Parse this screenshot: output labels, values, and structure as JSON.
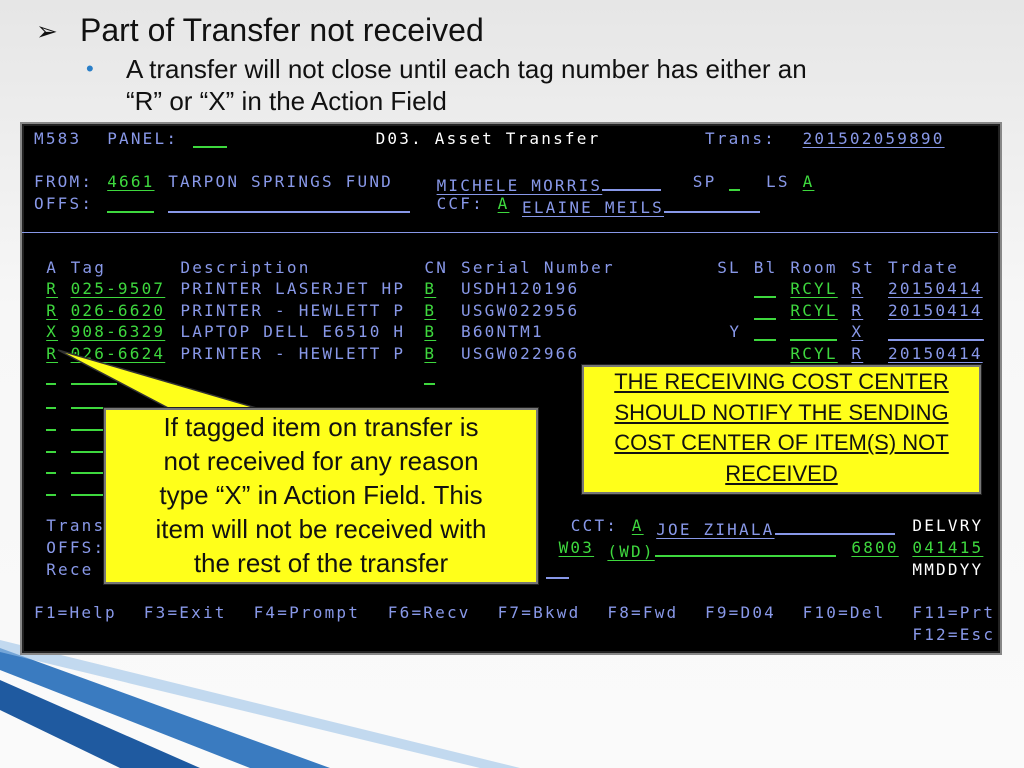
{
  "slide": {
    "title": "Part of Transfer not received",
    "bullet": "A transfer will not close until each tag number has either an",
    "bullet_line2": "“R” or “X” in the Action Field"
  },
  "terminal": {
    "program": "M583",
    "panel_label": "PANEL:",
    "screen_title": "D03. Asset Transfer",
    "trans_label": "Trans:",
    "trans_number": "201502059890",
    "from_label": "FROM:",
    "from_code": "4661",
    "from_name": "TARPON SPRINGS FUND",
    "from_contact": "MICHELE MORRIS",
    "sp_label": "SP",
    "ls_label": "LS",
    "ls_value": "A",
    "offs_label": "OFFS:",
    "ccf_label": "CCF:",
    "ccf_value": "A",
    "ccf_contact": "ELAINE MEILS",
    "columns": [
      "A",
      "Tag",
      "Description",
      "CN",
      "Serial Number",
      "SL",
      "Bl",
      "Room",
      "St",
      "Trdate"
    ],
    "rows": [
      {
        "action": "R",
        "tag": "025-9507",
        "description": "PRINTER LASERJET HP",
        "cn": "B",
        "serial": "USDH120196",
        "sl": "",
        "room": "RCYL",
        "st": "R",
        "trdate": "20150414"
      },
      {
        "action": "R",
        "tag": "026-6620",
        "description": "PRINTER - HEWLETT P",
        "cn": "B",
        "serial": "USGW022956",
        "sl": "",
        "room": "RCYL",
        "st": "R",
        "trdate": "20150414"
      },
      {
        "action": "X",
        "tag": "908-6329",
        "description": "LAPTOP DELL E6510 H",
        "cn": "B",
        "serial": "B60NTM1",
        "sl": "Y",
        "room": "",
        "st": "X",
        "trdate": ""
      },
      {
        "action": "R",
        "tag": "026-6624",
        "description": "PRINTER - HEWLETT P",
        "cn": "B",
        "serial": "USGW022966",
        "sl": "",
        "room": "RCYL",
        "st": "R",
        "trdate": "20150414"
      }
    ],
    "trans_label_bottom": "Trans",
    "offs_label_bottom": "OFFS:",
    "rece_label": "Rece",
    "cct_label": "CCT:",
    "cct_value": "A",
    "cct_contact": "JOE ZIHALA",
    "delvry_label": "DELVRY",
    "offs_code": "W03",
    "offs_name": "(WD)",
    "offs_number": "6800",
    "delivery_date": "041415",
    "date_format": "MMDDYY",
    "fkeys": [
      "F1=Help",
      "F3=Exit",
      "F4=Prompt",
      "F6=Recv",
      "F7=Bkwd",
      "F8=Fwd",
      "F9=D04",
      "F10=Del",
      "F11=Prt",
      "F12=Esc"
    ]
  },
  "callouts": {
    "left": [
      "If tagged item on transfer is",
      "not received for any reason",
      "type “X” in Action Field. This",
      "item will not be received with",
      "the rest of the transfer"
    ],
    "right": [
      "THE RECEIVING COST CENTER",
      "SHOULD NOTIFY THE SENDING",
      "COST CENTER OF ITEM(S) NOT",
      "RECEIVED"
    ]
  },
  "colors": {
    "terminal_text": "#8898e8",
    "field_green": "#3ed83e",
    "callout_yellow": "#ffff1a",
    "bullet_blue": "#2a7fc8"
  }
}
